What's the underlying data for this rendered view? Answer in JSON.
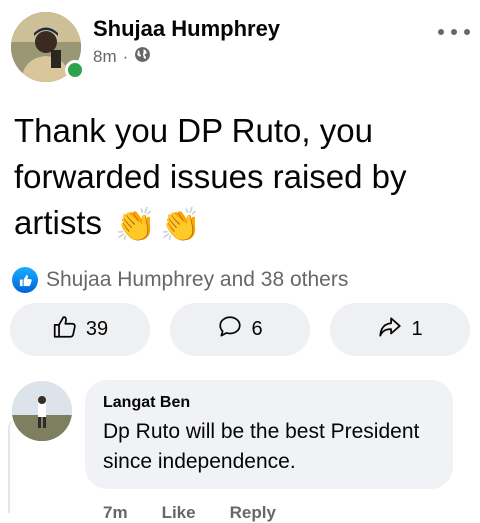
{
  "post": {
    "author": "Shujaa Humphrey",
    "time": "8m",
    "separator": "·",
    "audience_icon": "globe-icon",
    "text": "Thank you DP Ruto, you forwarded issues raised by artists",
    "emoji": [
      "👏",
      "👏"
    ]
  },
  "reactions": {
    "icon": "like-icon",
    "summary": "Shujaa Humphrey and 38 others"
  },
  "actions": {
    "like_count": "39",
    "comment_count": "6",
    "share_count": "1"
  },
  "comment": {
    "author": "Langat Ben",
    "text": "Dp Ruto will be the best President since independence.",
    "time": "7m",
    "like_label": "Like",
    "reply_label": "Reply"
  },
  "colors": {
    "online": "#31a24c",
    "like_blue": "#1877f2",
    "secondary_text": "#65676b",
    "button_bg": "#eff0f2",
    "bubble_bg": "#f0f2f5"
  }
}
